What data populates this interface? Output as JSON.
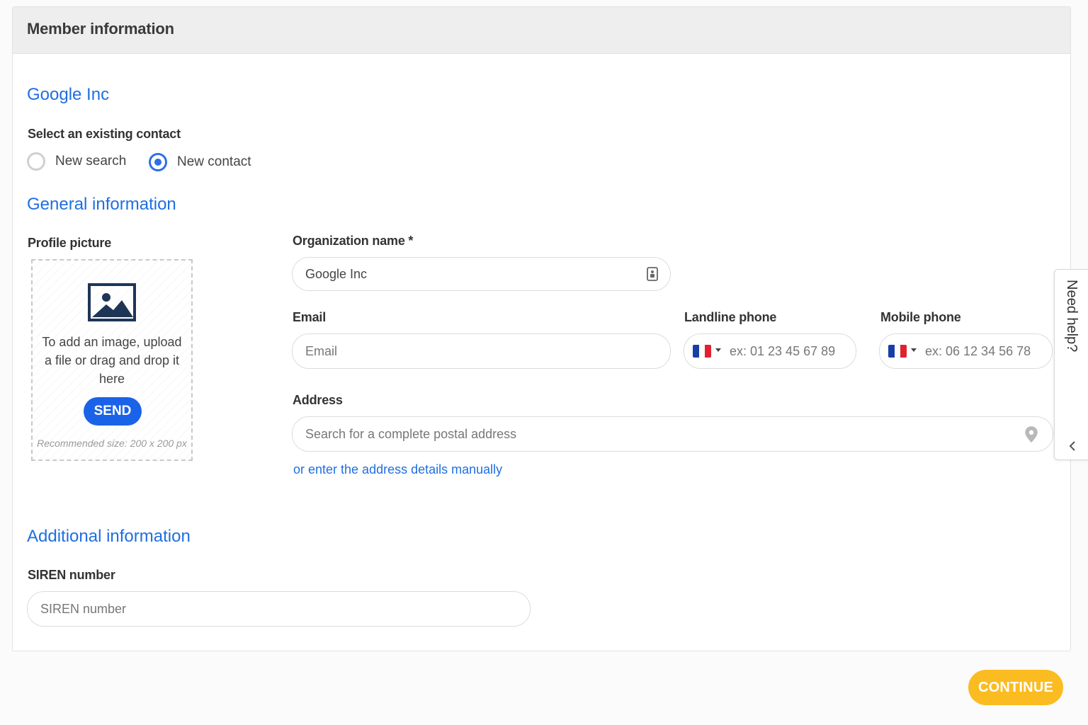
{
  "panel": {
    "title": "Member information"
  },
  "company_name": "Google Inc",
  "contact_select": {
    "label": "Select an existing contact",
    "options": [
      {
        "label": "New search",
        "checked": false
      },
      {
        "label": "New contact",
        "checked": true
      }
    ]
  },
  "general": {
    "title": "General information",
    "profile_picture": {
      "label": "Profile picture",
      "dropzone_text": "To add an image, upload a file or drag and drop it here",
      "send_label": "SEND",
      "hint": "Recommended size: 200 x 200 px"
    },
    "org_name": {
      "label": "Organization name *",
      "value": "Google Inc"
    },
    "email": {
      "label": "Email",
      "placeholder": "Email"
    },
    "landline": {
      "label": "Landline phone",
      "placeholder": "ex: 01 23 45 67 89",
      "country": "France"
    },
    "mobile": {
      "label": "Mobile phone",
      "placeholder": "ex: 06 12 34 56 78",
      "country": "France"
    },
    "address": {
      "label": "Address",
      "placeholder": "Search for a complete postal address",
      "manual_link": "or enter the address details manually"
    }
  },
  "additional": {
    "title": "Additional information",
    "siren": {
      "label": "SIREN number",
      "placeholder": "SIREN number"
    }
  },
  "help_tab": {
    "label": "Need help?"
  },
  "continue_label": "CONTINUE",
  "colors": {
    "accent_blue": "#1f6fe0",
    "send_blue": "#1a63e8",
    "continue_yellow": "#fbbc22",
    "header_gray": "#eeeeee",
    "flag_blue": "#1a3ea8",
    "flag_red": "#e0212f"
  },
  "icons": [
    "image-icon",
    "contact-card-icon",
    "map-pin-icon",
    "chevron-left-icon",
    "caret-down-icon"
  ]
}
